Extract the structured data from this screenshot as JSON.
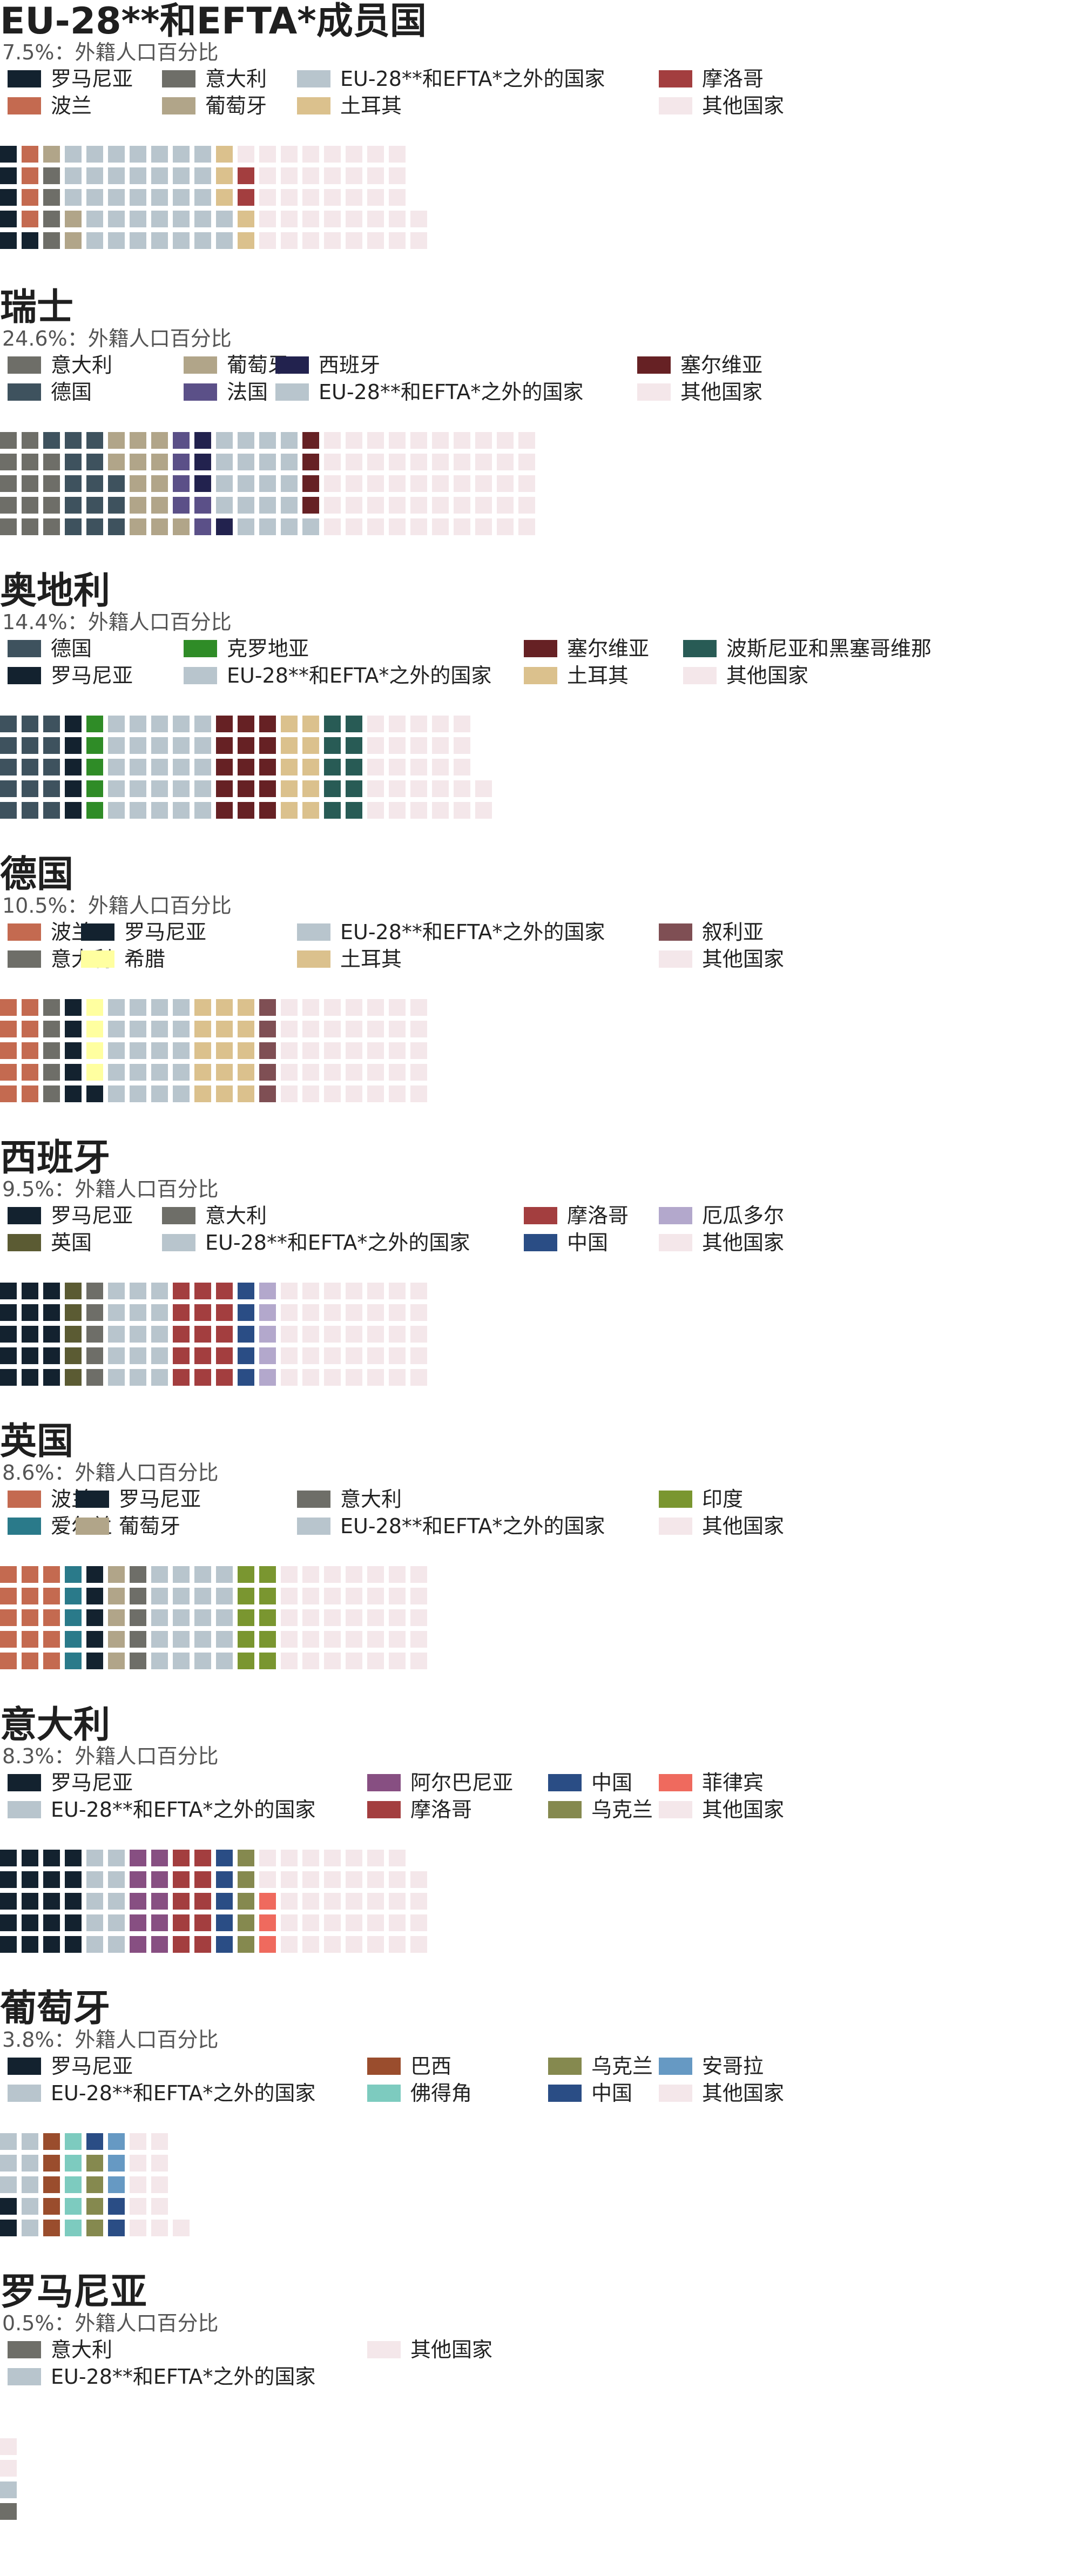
{
  "colors": {
    "romania": "#13222f",
    "poland": "#c46a50",
    "italy": "#6e6e68",
    "portugal": "#b1a589",
    "non_eu": "#b8c5cd",
    "turkey": "#dbc18d",
    "morocco": "#a33e3f",
    "other": "#f4e7ea",
    "germany": "#3e525e",
    "spain": "#22224e",
    "france": "#5b5088",
    "serbia": "#662124",
    "croatia": "#2f8c27",
    "bosnia": "#285b55",
    "greece": "#ffffa0",
    "syria": "#7f4f54",
    "uk": "#5b5b33",
    "china": "#2a4d85",
    "ecuador": "#b3a8cc",
    "ireland": "#2a7a8a",
    "india": "#7a9630",
    "albania": "#874f82",
    "ukraine": "#85894f",
    "philippines": "#ef6a5e",
    "brazil": "#9a4d2d",
    "cape_verde": "#7dcbbf",
    "angola": "#6699c3"
  },
  "chart_data": [
    {
      "type": "waffle",
      "title": "EU-28**和EFTA*成员国",
      "subtitle": "7.5%：外籍人口百分比",
      "legend": [
        {
          "label": "罗马尼亚",
          "color": "#13222f"
        },
        {
          "label": "波兰",
          "color": "#c46a50"
        },
        {
          "label": "意大利",
          "color": "#6e6e68"
        },
        {
          "label": "葡萄牙",
          "color": "#b1a589"
        },
        {
          "label": "EU-28**和EFTA*之外的国家",
          "color": "#b8c5cd"
        },
        {
          "label": "土耳其",
          "color": "#dbc18d"
        },
        {
          "label": "摩洛哥",
          "color": "#a33e3f"
        },
        {
          "label": "其他国家",
          "color": "#f4e7ea"
        }
      ],
      "values": [
        6,
        4,
        4,
        3,
        35,
        5,
        2,
        38
      ]
    },
    {
      "type": "waffle",
      "title": "瑞士",
      "subtitle": "24.6%：外籍人口百分比",
      "legend": [
        {
          "label": "意大利",
          "color": "#6e6e68"
        },
        {
          "label": "德国",
          "color": "#3e525e"
        },
        {
          "label": "葡萄牙",
          "color": "#b1a589"
        },
        {
          "label": "法国",
          "color": "#5b5088"
        },
        {
          "label": "西班牙",
          "color": "#22224e"
        },
        {
          "label": "EU-28**和EFTA*之外的国家",
          "color": "#b8c5cd"
        },
        {
          "label": "塞尔维亚",
          "color": "#662124"
        },
        {
          "label": "其他国家",
          "color": "#f4e7ea"
        }
      ],
      "values": [
        14,
        14,
        13,
        6,
        4,
        20,
        4,
        50
      ]
    },
    {
      "type": "waffle",
      "title": "奥地利",
      "subtitle": "14.4%：外籍人口百分比",
      "legend": [
        {
          "label": "德国",
          "color": "#3e525e"
        },
        {
          "label": "罗马尼亚",
          "color": "#13222f"
        },
        {
          "label": "克罗地亚",
          "color": "#2f8c27"
        },
        {
          "label": "EU-28**和EFTA*之外的国家",
          "color": "#b8c5cd"
        },
        {
          "label": "塞尔维亚",
          "color": "#662124"
        },
        {
          "label": "土耳其",
          "color": "#dbc18d"
        },
        {
          "label": "波斯尼亚和黑塞哥维那",
          "color": "#285b55"
        },
        {
          "label": "其他国家",
          "color": "#f4e7ea"
        }
      ],
      "values": [
        15,
        5,
        5,
        25,
        15,
        10,
        10,
        27
      ]
    },
    {
      "type": "waffle",
      "title": "德国",
      "subtitle": "10.5%：外籍人口百分比",
      "legend": [
        {
          "label": "波兰",
          "color": "#c46a50"
        },
        {
          "label": "意大利",
          "color": "#6e6e68"
        },
        {
          "label": "罗马尼亚",
          "color": "#13222f"
        },
        {
          "label": "希腊",
          "color": "#ffffa0"
        },
        {
          "label": "EU-28**和EFTA*之外的国家",
          "color": "#b8c5cd"
        },
        {
          "label": "土耳其",
          "color": "#dbc18d"
        },
        {
          "label": "叙利亚",
          "color": "#7f4f54"
        },
        {
          "label": "其他国家",
          "color": "#f4e7ea"
        }
      ],
      "values": [
        10,
        5,
        6,
        4,
        20,
        15,
        5,
        35
      ]
    },
    {
      "type": "waffle",
      "title": "西班牙",
      "subtitle": "9.5%：外籍人口百分比",
      "legend": [
        {
          "label": "罗马尼亚",
          "color": "#13222f"
        },
        {
          "label": "英国",
          "color": "#5b5b33"
        },
        {
          "label": "意大利",
          "color": "#6e6e68"
        },
        {
          "label": "EU-28**和EFTA*之外的国家",
          "color": "#b8c5cd"
        },
        {
          "label": "摩洛哥",
          "color": "#a33e3f"
        },
        {
          "label": "中国",
          "color": "#2a4d85"
        },
        {
          "label": "厄瓜多尔",
          "color": "#b3a8cc"
        },
        {
          "label": "其他国家",
          "color": "#f4e7ea"
        }
      ],
      "values": [
        15,
        5,
        5,
        15,
        15,
        5,
        5,
        35
      ]
    },
    {
      "type": "waffle",
      "title": "英国",
      "subtitle": "8.6%：外籍人口百分比",
      "legend": [
        {
          "label": "波兰",
          "color": "#c46a50"
        },
        {
          "label": "爱尔兰",
          "color": "#2a7a8a"
        },
        {
          "label": "罗马尼亚",
          "color": "#13222f"
        },
        {
          "label": "葡萄牙",
          "color": "#b1a589"
        },
        {
          "label": "意大利",
          "color": "#6e6e68"
        },
        {
          "label": "EU-28**和EFTA*之外的国家",
          "color": "#b8c5cd"
        },
        {
          "label": "印度",
          "color": "#7a9630"
        },
        {
          "label": "其他国家",
          "color": "#f4e7ea"
        }
      ],
      "values": [
        15,
        5,
        5,
        5,
        5,
        20,
        10,
        35
      ]
    },
    {
      "type": "waffle",
      "title": "意大利",
      "subtitle": "8.3%：外籍人口百分比",
      "legend": [
        {
          "label": "罗马尼亚",
          "color": "#13222f"
        },
        {
          "label": "EU-28**和EFTA*之外的国家",
          "color": "#b8c5cd"
        },
        {
          "label": "阿尔巴尼亚",
          "color": "#874f82"
        },
        {
          "label": "摩洛哥",
          "color": "#a33e3f"
        },
        {
          "label": "中国",
          "color": "#2a4d85"
        },
        {
          "label": "乌克兰",
          "color": "#85894f"
        },
        {
          "label": "菲律宾",
          "color": "#ef6a5e"
        },
        {
          "label": "其他国家",
          "color": "#f4e7ea"
        }
      ],
      "values": [
        20,
        10,
        10,
        10,
        5,
        5,
        3,
        36
      ]
    },
    {
      "type": "waffle",
      "title": "葡萄牙",
      "subtitle": "3.8%：外籍人口百分比",
      "legend": [
        {
          "label": "罗马尼亚",
          "color": "#13222f"
        },
        {
          "label": "EU-28**和EFTA*之外的国家",
          "color": "#b8c5cd"
        },
        {
          "label": "巴西",
          "color": "#9a4d2d"
        },
        {
          "label": "佛得角",
          "color": "#7dcbbf"
        },
        {
          "label": "乌克兰",
          "color": "#85894f"
        },
        {
          "label": "中国",
          "color": "#2a4d85"
        },
        {
          "label": "安哥拉",
          "color": "#6699c3"
        },
        {
          "label": "其他国家",
          "color": "#f4e7ea"
        }
      ],
      "values": [
        2,
        8,
        5,
        5,
        4,
        3,
        3,
        11
      ]
    },
    {
      "type": "waffle",
      "title": "罗马尼亚",
      "subtitle": "0.5%：外籍人口百分比",
      "legend": [
        {
          "label": "意大利",
          "color": "#6e6e68"
        },
        {
          "label": "EU-28**和EFTA*之外的国家",
          "color": "#b8c5cd"
        },
        {
          "label": "其他国家",
          "color": "#f4e7ea"
        }
      ],
      "values": [
        1,
        1,
        2
      ]
    }
  ]
}
